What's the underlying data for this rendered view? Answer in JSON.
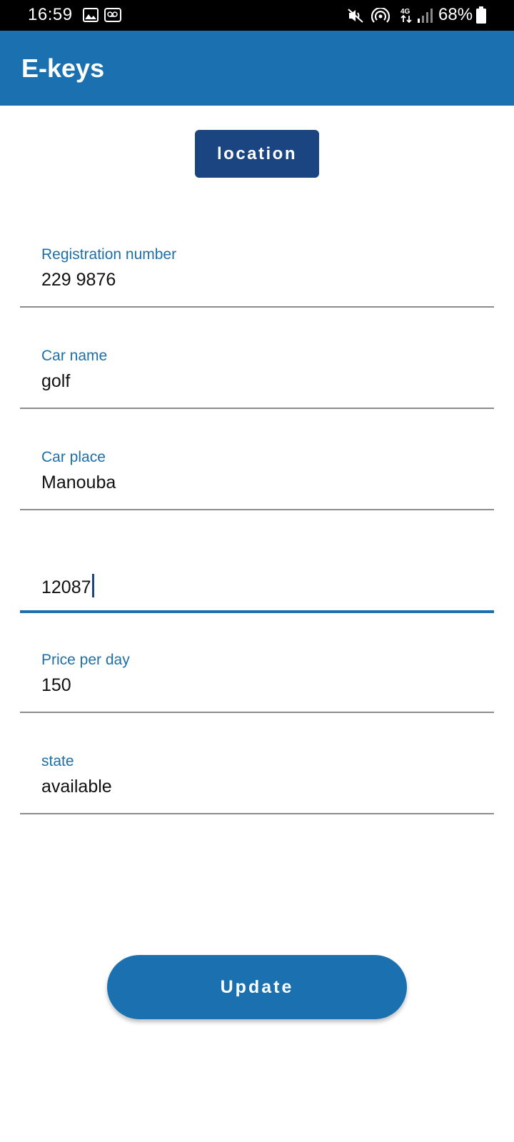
{
  "status_bar": {
    "time": "16:59",
    "battery": "68%",
    "icons": [
      "image-icon",
      "voicemail-icon",
      "mute-icon",
      "hotspot-icon",
      "4g-icon",
      "signal-icon",
      "battery-icon"
    ]
  },
  "app_bar": {
    "title": "E-keys"
  },
  "location_button": {
    "label": "location"
  },
  "fields": {
    "registration": {
      "label": "Registration number",
      "value": "229 9876"
    },
    "car_name": {
      "label": "Car name",
      "value": "golf"
    },
    "car_place": {
      "label": "Car place",
      "value": "Manouba"
    },
    "unlabeled": {
      "value": "12087"
    },
    "price": {
      "label": "Price per day",
      "value": "150"
    },
    "state": {
      "label": "state",
      "value": "available"
    }
  },
  "update_button": {
    "label": "Update"
  },
  "colors": {
    "app_bar": "#1b71b0",
    "location_button": "#1b4580",
    "label": "#1e6fa8",
    "update_button": "#1b71b0"
  }
}
